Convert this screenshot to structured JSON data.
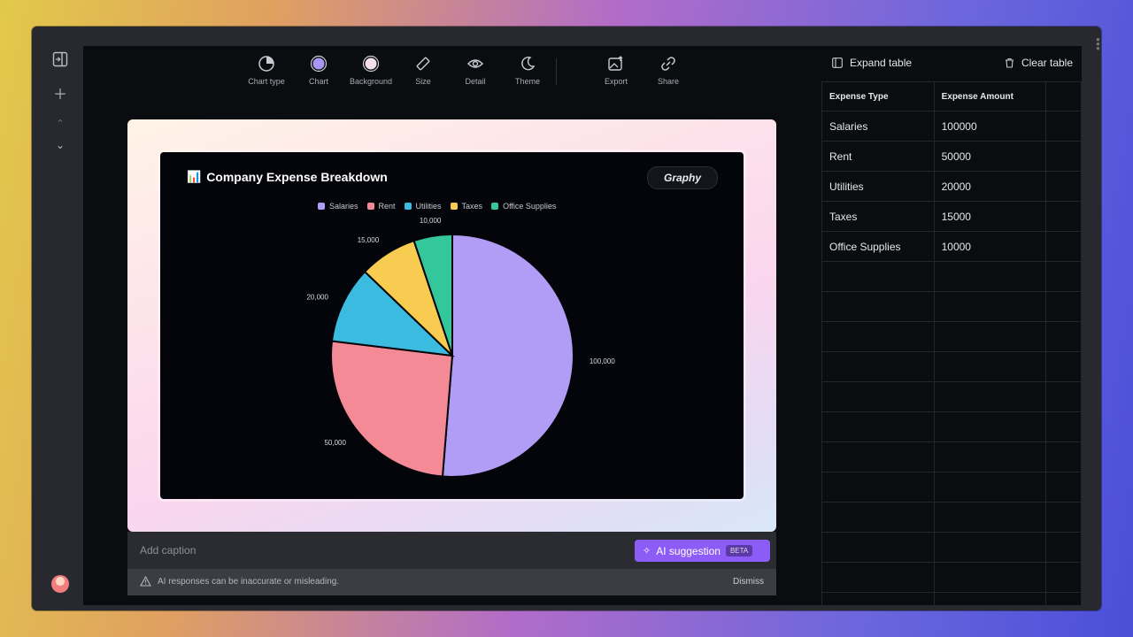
{
  "toolbar": {
    "items": [
      {
        "label": "Chart type",
        "icon": "pie-chart-icon"
      },
      {
        "label": "Chart",
        "icon": "chart-color-icon"
      },
      {
        "label": "Background",
        "icon": "background-color-icon"
      },
      {
        "label": "Size",
        "icon": "ruler-icon"
      },
      {
        "label": "Detail",
        "icon": "eye-icon"
      },
      {
        "label": "Theme",
        "icon": "moon-icon"
      },
      {
        "label": "Export",
        "icon": "image-export-icon"
      },
      {
        "label": "Share",
        "icon": "link-icon"
      }
    ]
  },
  "chart_data": {
    "type": "pie",
    "title": "Company Expense Breakdown",
    "categories": [
      "Salaries",
      "Rent",
      "Utilities",
      "Taxes",
      "Office Supplies"
    ],
    "values": [
      100000,
      50000,
      20000,
      15000,
      10000
    ],
    "value_labels": [
      "100,000",
      "50,000",
      "20,000",
      "15,000",
      "10,000"
    ],
    "colors": [
      "#b19cf6",
      "#f48a95",
      "#3bbbe0",
      "#f7cc50",
      "#33c79b"
    ],
    "legend_labels": [
      "Salaries",
      "Rent",
      "Utilities",
      "Taxes",
      "Office Supplies"
    ],
    "legend_position": "top"
  },
  "brand": {
    "badge": "Graphy"
  },
  "caption": {
    "placeholder": "Add caption"
  },
  "ai": {
    "label": "AI suggestion",
    "badge": "BETA"
  },
  "notice": {
    "text": "AI responses can be inaccurate or misleading.",
    "dismiss": "Dismiss"
  },
  "table": {
    "expand_label": "Expand table",
    "clear_label": "Clear table",
    "headers": [
      "Expense Type",
      "Expense Amount"
    ],
    "rows": [
      [
        "Salaries",
        "100000"
      ],
      [
        "Rent",
        "50000"
      ],
      [
        "Utilities",
        "20000"
      ],
      [
        "Taxes",
        "15000"
      ],
      [
        "Office Supplies",
        "10000"
      ]
    ]
  }
}
